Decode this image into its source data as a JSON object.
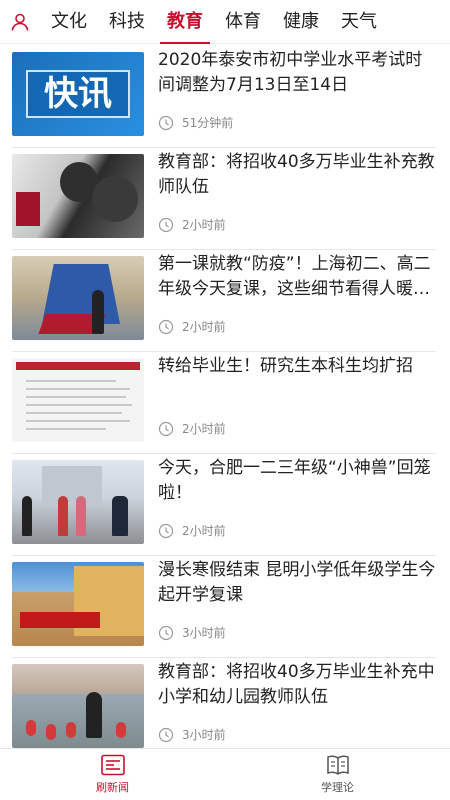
{
  "header": {
    "profile_icon": "user-icon",
    "tabs": [
      {
        "label": "文化",
        "active": false
      },
      {
        "label": "科技",
        "active": false
      },
      {
        "label": "教育",
        "active": true
      },
      {
        "label": "体育",
        "active": false
      },
      {
        "label": "健康",
        "active": false
      },
      {
        "label": "天气",
        "active": false
      }
    ]
  },
  "news": [
    {
      "title": "2020年泰安市初中学业水平考试时间调整为7月13日至14日",
      "time": "51分钟前",
      "thumb_text": "快讯"
    },
    {
      "title": "教育部：将招收40多万毕业生补充教师队伍",
      "time": "2小时前"
    },
    {
      "title": "第一课就教“防疫”！上海初二、高二年级今天复课，这些细节看得人暖暖的",
      "time": "2小时前"
    },
    {
      "title": "转给毕业生！研究生本科生均扩招",
      "time": "2小时前"
    },
    {
      "title": "今天，合肥一二三年级“小神兽”回笼啦！",
      "time": "2小时前"
    },
    {
      "title": "漫长寒假结束 昆明小学低年级学生今起开学复课",
      "time": "3小时前"
    },
    {
      "title": "教育部：将招收40多万毕业生补充中小学和幼儿园教师队伍",
      "time": "3小时前"
    }
  ],
  "bottom_nav": [
    {
      "label": "刷新闻",
      "icon": "news-icon",
      "active": true
    },
    {
      "label": "学理论",
      "icon": "book-icon",
      "active": false
    }
  ],
  "colors": {
    "accent": "#c8102e",
    "meta": "#888888",
    "divider": "#e6e6e6"
  }
}
